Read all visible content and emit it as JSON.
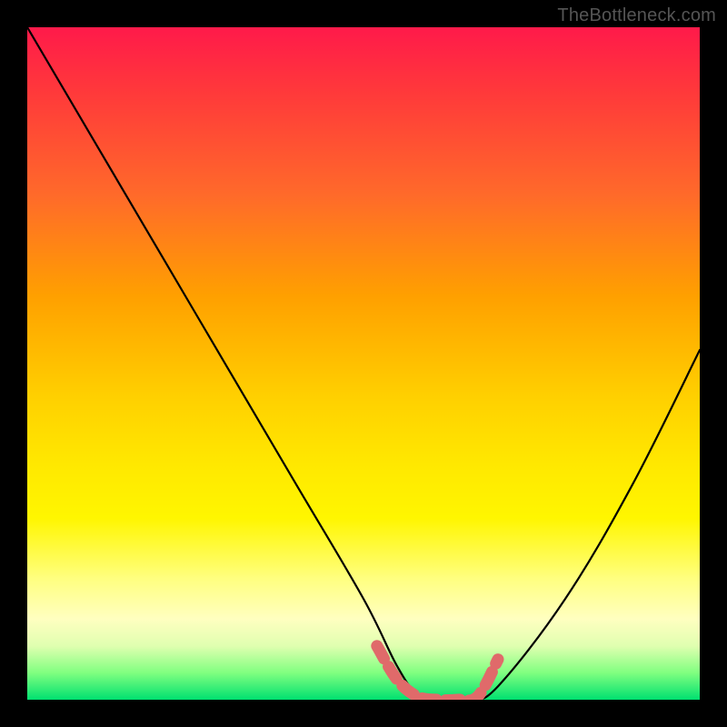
{
  "watermark": "TheBottleneck.com",
  "chart_data": {
    "type": "line",
    "title": "",
    "xlabel": "",
    "ylabel": "",
    "xlim": [
      0,
      100
    ],
    "ylim": [
      0,
      100
    ],
    "series": [
      {
        "name": "bottleneck-curve",
        "x": [
          0,
          10,
          20,
          30,
          40,
          50,
          55,
          58,
          62,
          66,
          70,
          80,
          90,
          100
        ],
        "values": [
          100,
          83,
          66,
          49,
          32,
          15,
          5,
          1,
          0,
          0,
          2,
          15,
          32,
          52
        ]
      }
    ],
    "highlight": {
      "name": "optimal-range",
      "x": [
        52,
        55,
        58,
        61,
        64,
        67,
        70
      ],
      "values": [
        8,
        3,
        0.5,
        0,
        0,
        0.5,
        6
      ],
      "color": "#e06a6a"
    },
    "background_gradient": {
      "top": "#ff1a4a",
      "upper_mid": "#ffa000",
      "mid": "#ffe800",
      "lower_mid": "#ffffc0",
      "bottom": "#00e070"
    }
  }
}
